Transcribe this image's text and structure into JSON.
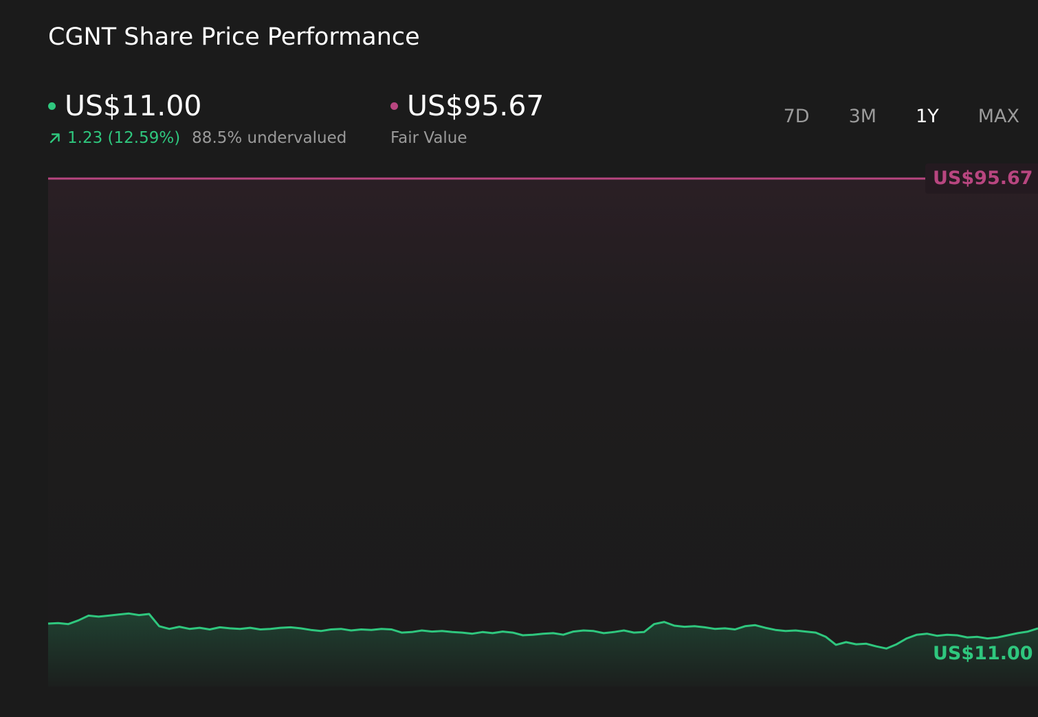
{
  "header": {
    "title": "CGNT Share Price Performance"
  },
  "price": {
    "value": "US$11.00",
    "change": "1.23 (12.59%)",
    "valuation": "88.5% undervalued",
    "color": "#2fc77e"
  },
  "fair_value": {
    "value": "US$95.67",
    "label": "Fair Value",
    "color": "#b84680"
  },
  "range_tabs": {
    "items": [
      "7D",
      "3M",
      "1Y",
      "MAX"
    ],
    "selected": "1Y"
  },
  "chart_data": {
    "type": "line",
    "title": "CGNT Share Price Performance",
    "ylim": [
      0,
      100
    ],
    "reference_line": {
      "name": "Fair Value",
      "value": 95.67,
      "label": "US$95.67",
      "color": "#b84680"
    },
    "end_label": "US$11.00",
    "series": [
      {
        "name": "CGNT",
        "color": "#2fc77e",
        "values": [
          11.9,
          12.0,
          11.8,
          12.5,
          13.4,
          13.2,
          13.4,
          13.6,
          13.8,
          13.5,
          13.7,
          11.4,
          10.9,
          11.3,
          10.9,
          11.1,
          10.8,
          11.2,
          11.0,
          10.9,
          11.1,
          10.8,
          10.9,
          11.1,
          11.2,
          11.0,
          10.7,
          10.5,
          10.8,
          10.9,
          10.6,
          10.8,
          10.7,
          10.9,
          10.8,
          10.2,
          10.3,
          10.6,
          10.4,
          10.5,
          10.3,
          10.2,
          10.0,
          10.3,
          10.1,
          10.4,
          10.2,
          9.7,
          9.8,
          10.0,
          10.1,
          9.8,
          10.4,
          10.6,
          10.5,
          10.1,
          10.3,
          10.6,
          10.2,
          10.3,
          11.8,
          12.2,
          11.5,
          11.3,
          11.4,
          11.2,
          10.9,
          11.0,
          10.8,
          11.4,
          11.6,
          11.1,
          10.7,
          10.5,
          10.6,
          10.4,
          10.2,
          9.4,
          7.9,
          8.4,
          8.0,
          8.1,
          7.6,
          7.2,
          8.0,
          9.1,
          9.8,
          10.0,
          9.6,
          9.8,
          9.7,
          9.3,
          9.4,
          9.1,
          9.3,
          9.7,
          10.1,
          10.4,
          11.0
        ]
      }
    ]
  }
}
